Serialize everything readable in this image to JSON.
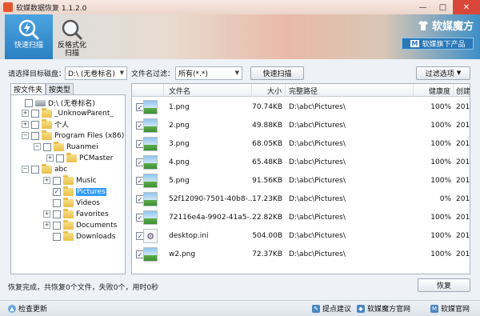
{
  "window": {
    "title": "软媒数据恢复 1.1.2.0",
    "minimize": "—",
    "maximize": "□",
    "close": "✕"
  },
  "toolbar": {
    "quick_scan": "快速扫描",
    "format_scan_line1": "反格式化",
    "format_scan_line2": "扫描",
    "brand": "软媒魔方",
    "shop_badge": "M",
    "shop_label": "软媒旗下产品"
  },
  "filter": {
    "disk_label": "请选择目标磁盘：",
    "disk_value": "D:\\ (无卷标名)",
    "name_filter_label": "文件名过滤：",
    "name_filter_value": "所有(*.*)",
    "scan_button": "快速扫描",
    "options_button": "过滤选项"
  },
  "left": {
    "tab_folders": "按文件夹",
    "tab_types": "按类型",
    "tree": [
      {
        "label": "D:\\ (无卷标名)",
        "exp": "",
        "checked": "",
        "kind": "drive"
      },
      {
        "label": "_UnknowParent_",
        "exp": "+",
        "checked": "",
        "kind": "folder"
      },
      {
        "label": "个人",
        "exp": "+",
        "checked": "",
        "kind": "folder"
      },
      {
        "label": "Program Files (x86)",
        "exp": "−",
        "checked": "",
        "kind": "folder"
      },
      {
        "label": "Ruanmei",
        "exp": "−",
        "checked": "",
        "kind": "folder"
      },
      {
        "label": "PCMaster",
        "exp": "+",
        "checked": "",
        "kind": "folder"
      },
      {
        "label": "abc",
        "exp": "−",
        "checked": "",
        "kind": "folder"
      },
      {
        "label": "Music",
        "exp": "+",
        "checked": "",
        "kind": "folder"
      },
      {
        "label": "Pictures",
        "exp": "",
        "checked": "✓",
        "kind": "folder"
      },
      {
        "label": "Videos",
        "exp": "",
        "checked": "",
        "kind": "folder"
      },
      {
        "label": "Favorites",
        "exp": "+",
        "checked": "",
        "kind": "folder"
      },
      {
        "label": "Documents",
        "exp": "+",
        "checked": "",
        "kind": "folder"
      },
      {
        "label": "Downloads",
        "exp": "",
        "checked": "",
        "kind": "folder"
      }
    ]
  },
  "table": {
    "columns": [
      "文件名",
      "大小",
      "完整路径",
      "健康度",
      "创建"
    ],
    "rows": [
      {
        "name": "1.png",
        "size": "70.74KB",
        "path": "D:\\abc\\Pictures\\",
        "health": "100%",
        "created": "2015"
      },
      {
        "name": "2.png",
        "size": "49.88KB",
        "path": "D:\\abc\\Pictures\\",
        "health": "100%",
        "created": "2015"
      },
      {
        "name": "3.png",
        "size": "68.05KB",
        "path": "D:\\abc\\Pictures\\",
        "health": "100%",
        "created": "2015"
      },
      {
        "name": "4.png",
        "size": "65.48KB",
        "path": "D:\\abc\\Pictures\\",
        "health": "100%",
        "created": "2015"
      },
      {
        "name": "5.png",
        "size": "91.56KB",
        "path": "D:\\abc\\Pictures\\",
        "health": "100%",
        "created": "2015"
      },
      {
        "name": "52f12090-7501-40b8-...",
        "size": "17.23KB",
        "path": "D:\\abc\\Pictures\\",
        "health": "0%",
        "created": "2015"
      },
      {
        "name": "72116e4a-9902-41a5-...",
        "size": "22.82KB",
        "path": "D:\\abc\\Pictures\\",
        "health": "100%",
        "created": "2015"
      },
      {
        "name": "desktop.ini",
        "size": "504.00B",
        "path": "D:\\abc\\Pictures\\",
        "health": "100%",
        "created": "2015"
      },
      {
        "name": "w2.png",
        "size": "72.37KB",
        "path": "D:\\abc\\Pictures\\",
        "health": "100%",
        "created": "2015"
      }
    ]
  },
  "status": {
    "message": "恢复完成，共恢复0个文件，失败0个，用时0秒",
    "recover_button": "恢复"
  },
  "bottom": {
    "check_update": "检查更新",
    "feedback": "提点建议",
    "official_site": "软媒魔方官网",
    "ruanmei_site": "软媒官网"
  },
  "colors": {
    "accent": "#2b80c3",
    "close": "#d9473a",
    "selection": "#3399ff"
  }
}
